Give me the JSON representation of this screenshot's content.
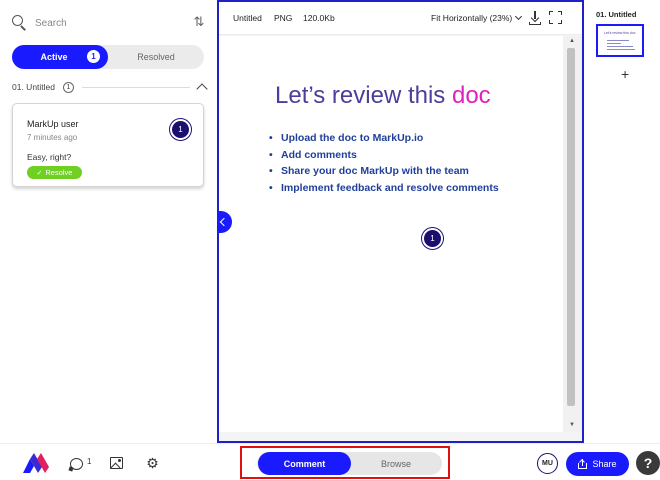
{
  "sidebar": {
    "search": {
      "placeholder": "Search"
    },
    "filter": {
      "active_label": "Active",
      "active_count": "1",
      "resolved_label": "Resolved"
    },
    "section": {
      "title": "01. Untitled",
      "count": "1"
    },
    "comment": {
      "user": "MarkUp user",
      "time": "7 minutes ago",
      "text": "Easy, right?",
      "pin": "1",
      "resolve_label": "Resolve"
    }
  },
  "viewer": {
    "toolbar": {
      "file_name": "Untitled",
      "file_type": "PNG",
      "file_size": "120.0Kb",
      "zoom": "Fit Horizontally (23%)"
    },
    "doc": {
      "title_main": "Let’s review this",
      "title_accent": "doc",
      "bullets": [
        "Upload the doc to MarkUp.io",
        "Add comments",
        "Share your doc MarkUp with the team",
        "Implement feedback and resolve comments"
      ],
      "pin": "1"
    }
  },
  "pages_panel": {
    "items": [
      {
        "label": "01. Untitled"
      }
    ],
    "add_label": "+"
  },
  "bottom_bar": {
    "comments_count": "1",
    "mode": {
      "comment_label": "Comment",
      "browse_label": "Browse",
      "selected": "Comment"
    },
    "avatar_initials": "MU",
    "share_label": "Share",
    "help_label": "?"
  },
  "colors": {
    "accent": "#1a1aff",
    "pin": "#1a0f6e",
    "resolve": "#6fcf23",
    "title": "#4a3f9a",
    "title_accent": "#e020c0",
    "highlight": "#e01010"
  },
  "icons": [
    "search-icon",
    "sort-icon",
    "chevron-up-icon",
    "check-icon",
    "download-icon",
    "fullscreen-icon",
    "chevron-left-icon",
    "logo",
    "comments-icon",
    "image-icon",
    "gear-icon",
    "share-icon",
    "help-icon"
  ]
}
